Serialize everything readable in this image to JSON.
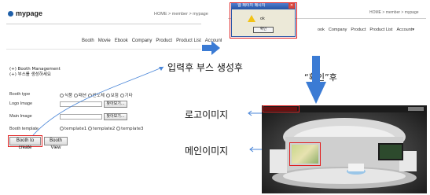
{
  "left": {
    "logo": "mypage",
    "breadcrumb": "HOME > member > mypage",
    "nav": [
      "Booth",
      "Movie",
      "Ebook",
      "Company",
      "Product",
      "Product List",
      "Account▾"
    ],
    "mgmt_lines": [
      "(+) Booth Management",
      "(+) 부스를 생성하세요"
    ],
    "form": {
      "booth_type_label": "Booth type",
      "booth_type_options": [
        "식품",
        "패션",
        "반도체",
        "보험",
        "기타"
      ],
      "logo_label": "Logo Image",
      "main_label": "Main Image",
      "find_button": "찾아보기...",
      "template_label": "Booth template",
      "template_options": [
        "template1",
        "template2",
        "template3"
      ]
    },
    "create_button": "Booth to create",
    "view_button": "Booth View"
  },
  "annotations": {
    "after_input": "입력후 부스 생성후",
    "after_confirm": "“확인”후",
    "logo_image": "로고이미지",
    "main_image": "메인이미지"
  },
  "right_top": {
    "logo": "mypage",
    "breadcrumb": "HOME > member > mypage",
    "nav": [
      "ook",
      "Company",
      "Product",
      "Product List",
      "Account▾"
    ],
    "dialog_title": "웹 페이지 메시지",
    "dialog_message": "ok",
    "dialog_ok": "확인"
  },
  "colors": {
    "accent_red": "#e02020",
    "arrow_blue": "#3b7bd4",
    "logo_blue": "#1f5fa8"
  }
}
